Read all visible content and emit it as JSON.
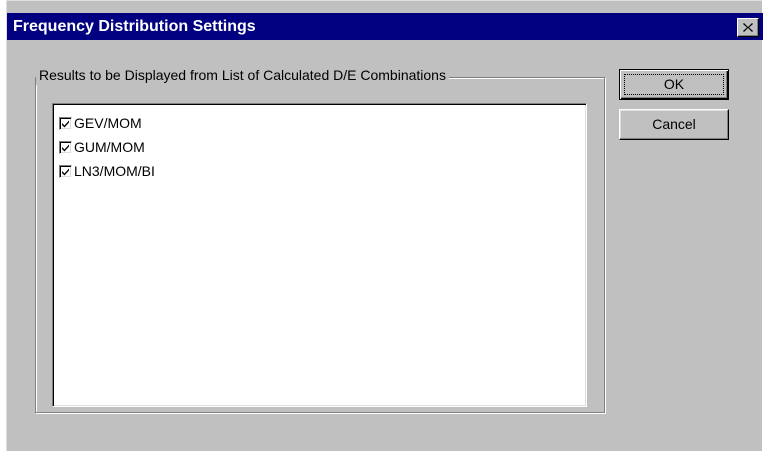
{
  "dialog": {
    "title": "Frequency Distribution Settings",
    "close_icon": "close-x-icon"
  },
  "group": {
    "label": "Results to be Displayed from List of Calculated D/E Combinations"
  },
  "list": {
    "items": [
      {
        "label": "GEV/MOM",
        "checked": true
      },
      {
        "label": "GUM/MOM",
        "checked": true
      },
      {
        "label": "LN3/MOM/BI",
        "checked": true
      }
    ]
  },
  "buttons": {
    "ok_label": "OK",
    "cancel_label": "Cancel"
  },
  "colors": {
    "titlebar": "#000080",
    "face": "#c0c0c0"
  }
}
